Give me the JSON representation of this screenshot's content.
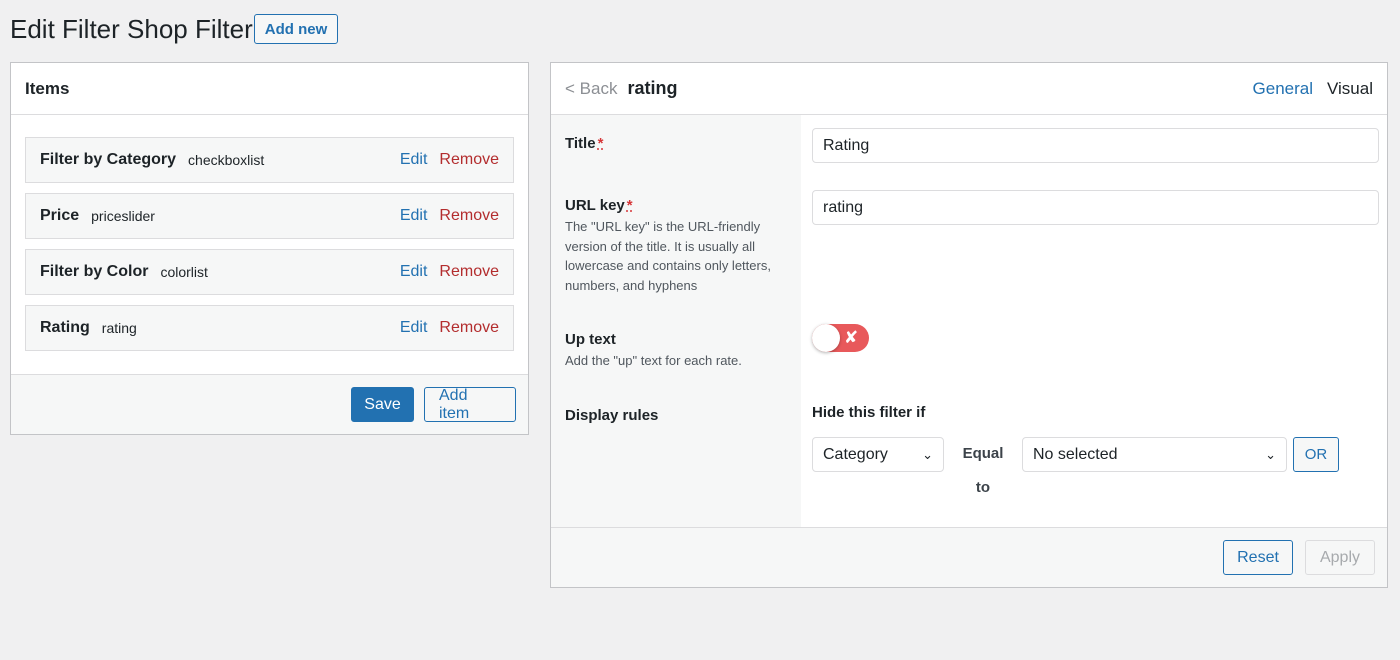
{
  "header": {
    "title": "Edit Filter Shop Filter",
    "add_new_label": "Add new"
  },
  "items_panel": {
    "title": "Items",
    "items": [
      {
        "name": "Filter by Category",
        "type": "checkboxlist",
        "edit": "Edit",
        "remove": "Remove"
      },
      {
        "name": "Price",
        "type": "priceslider",
        "edit": "Edit",
        "remove": "Remove"
      },
      {
        "name": "Filter by Color",
        "type": "colorlist",
        "edit": "Edit",
        "remove": "Remove"
      },
      {
        "name": "Rating",
        "type": "rating",
        "edit": "Edit",
        "remove": "Remove"
      }
    ],
    "save_label": "Save",
    "add_item_label": "Add item"
  },
  "edit_panel": {
    "back_label": "< Back",
    "item_title": "rating",
    "tabs": [
      {
        "label": "General",
        "active": true
      },
      {
        "label": "Visual",
        "active": false
      }
    ],
    "fields": {
      "title_label": "Title",
      "title_value": "Rating",
      "required_mark": "*",
      "url_key_label": "URL key",
      "url_key_value": "rating",
      "url_key_desc": "The \"URL key\" is the URL-friendly version of the title. It is usually all lowercase and contains only letters, numbers, and hyphens",
      "up_text_label": "Up text",
      "up_text_desc": "Add the \"up\" text for each rate.",
      "up_text_enabled": false,
      "up_text_toggle_glyph": "✘",
      "display_rules_label": "Display rules",
      "hide_if_label": "Hide this filter if",
      "rule_field_value": "Category",
      "rule_operator": "Equal to",
      "rule_value": "No selected",
      "or_label": "OR",
      "chevron_glyph": "⌄"
    },
    "reset_label": "Reset",
    "apply_label": "Apply"
  },
  "colors": {
    "accent": "#2271b1",
    "danger": "#b32d2e",
    "toggle_off": "#e8595b"
  }
}
